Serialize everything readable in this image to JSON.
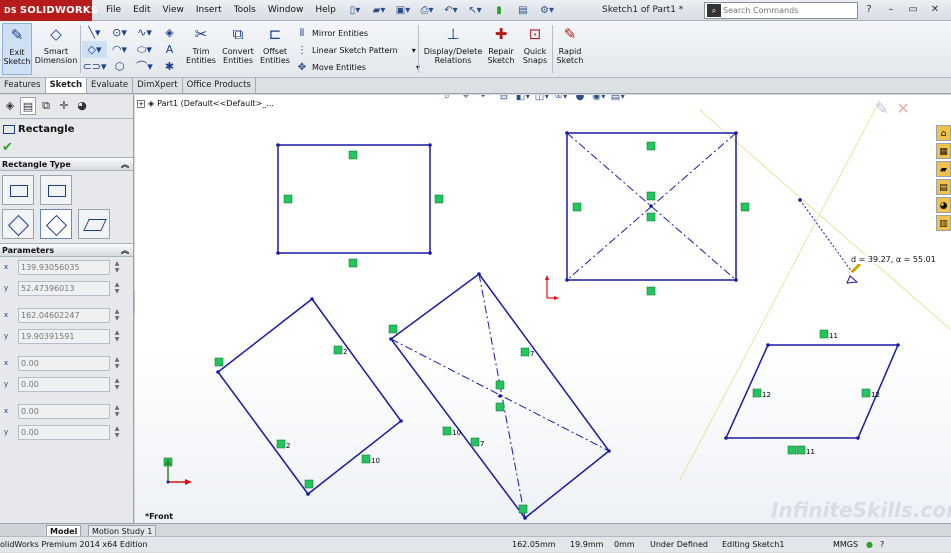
{
  "titlebar": {
    "logo": "SOLIDWORKS",
    "logo_prefix": "DS",
    "menus": [
      "File",
      "Edit",
      "View",
      "Insert",
      "Tools",
      "Window",
      "Help"
    ],
    "document_title": "Sketch1 of Part1 *",
    "search_placeholder": "Search Commands"
  },
  "command_manager": {
    "exit_sketch": "Exit Sketch",
    "smart_dimension": "Smart Dimension",
    "trim_entities": "Trim Entities",
    "convert_entities": "Convert Entities",
    "offset_entities": "Offset Entities",
    "mirror_entities": "Mirror Entities",
    "linear_sketch_pattern": "Linear Sketch Pattern",
    "move_entities": "Move Entities",
    "display_delete_relations": "Display/Delete Relations",
    "repair_sketch": "Repair Sketch",
    "quick_snaps": "Quick Snaps",
    "rapid_sketch": "Rapid Sketch"
  },
  "tabs": [
    "Features",
    "Sketch",
    "Evaluate",
    "DimXpert",
    "Office Products"
  ],
  "active_tab": "Sketch",
  "property_manager": {
    "title": "Rectangle",
    "rectangle_type_header": "Rectangle Type",
    "parameters_header": "Parameters",
    "params": [
      {
        "label": "x",
        "value": "139.93056035"
      },
      {
        "label": "y",
        "value": "52.47396013"
      },
      {
        "label": "x",
        "value": "162.04602247"
      },
      {
        "label": "y",
        "value": "19.90391591"
      },
      {
        "label": "x",
        "value": "0.00"
      },
      {
        "label": "y",
        "value": "0.00"
      },
      {
        "label": "x",
        "value": "0.00"
      },
      {
        "label": "y",
        "value": "0.00"
      }
    ]
  },
  "graphics": {
    "tree_root": "Part1  (Default<<Default>_...",
    "view_label": "*Front",
    "dimension_readout": "d = 39.27, α = 55.01",
    "relation_labels": [
      "2",
      "2",
      "10",
      "10",
      "7",
      "7",
      "11",
      "11",
      "12",
      "12"
    ],
    "watermark": "InfiniteSkills.com"
  },
  "bottom_tabs": [
    "Model",
    "Motion Study 1"
  ],
  "status": {
    "edition": "olidWorks Premium 2014 x64 Edition",
    "x": "162.05mm",
    "y": "19.9mm",
    "z": "0mm",
    "state": "Under Defined",
    "editing": "Editing Sketch1",
    "units": "MMGS"
  },
  "colors": {
    "sketch_line": "#1a1aa8",
    "relation_badge": "#22c55e",
    "logo_bg": "#b71c1c",
    "status_dot": "#2b9e2b"
  }
}
